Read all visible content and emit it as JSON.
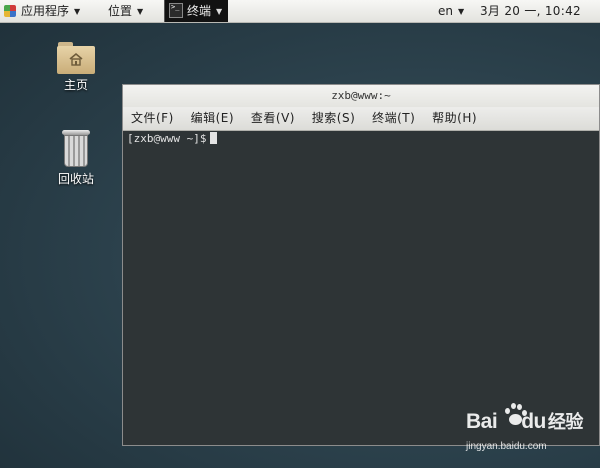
{
  "top_panel": {
    "apps_menu_label": "应用程序",
    "places_menu_label": "位置",
    "task_label": "终端",
    "language": "en",
    "clock": "3月 20 一, 10:42"
  },
  "desktop": {
    "icons": [
      {
        "label": "主页",
        "icon": "home-folder-icon"
      },
      {
        "label": "回收站",
        "icon": "trash-icon"
      }
    ]
  },
  "terminal": {
    "title": "zxb@www:~",
    "menu": [
      "文件(F)",
      "编辑(E)",
      "查看(V)",
      "搜索(S)",
      "终端(T)",
      "帮助(H)"
    ],
    "prompt": "[zxb@www ~]$"
  },
  "watermark": {
    "brand_left": "Bai",
    "brand_right": "du",
    "brand_suffix": "经验",
    "url": "jingyan.baidu.com"
  },
  "colors": {
    "desktop_bg": "#2d434e",
    "terminal_bg": "#2e3436",
    "panel_bg": "#ececea"
  }
}
